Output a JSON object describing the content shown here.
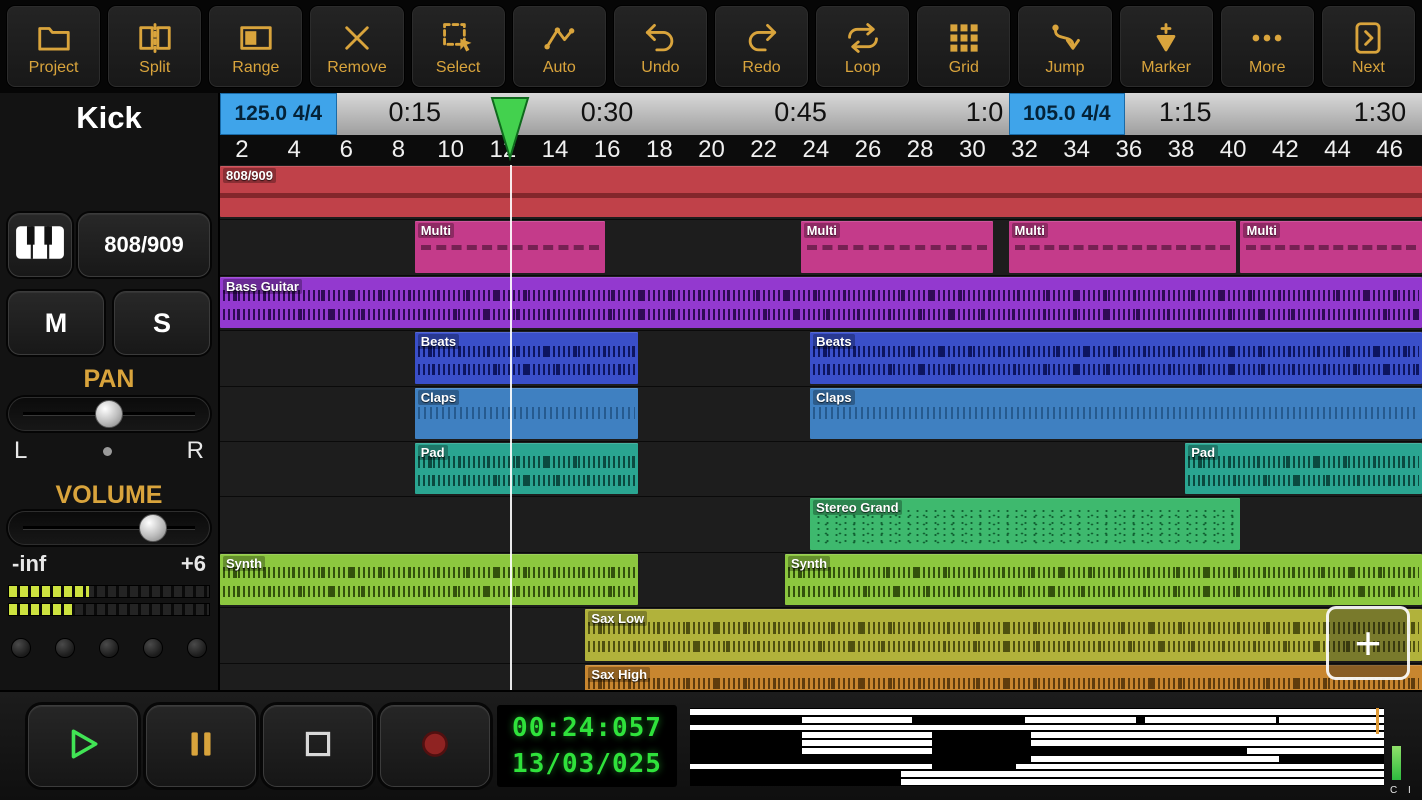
{
  "toolbar": {
    "items": [
      {
        "label": "Project",
        "icon": "folder"
      },
      {
        "label": "Split",
        "icon": "split"
      },
      {
        "label": "Range",
        "icon": "range"
      },
      {
        "label": "Remove",
        "icon": "remove"
      },
      {
        "label": "Select",
        "icon": "select"
      },
      {
        "label": "Auto",
        "icon": "auto"
      },
      {
        "label": "Undo",
        "icon": "undo"
      },
      {
        "label": "Redo",
        "icon": "redo"
      },
      {
        "label": "Loop",
        "icon": "loop"
      },
      {
        "label": "Grid",
        "icon": "grid"
      },
      {
        "label": "Jump",
        "icon": "jump"
      },
      {
        "label": "Marker",
        "icon": "marker"
      },
      {
        "label": "More",
        "icon": "more"
      },
      {
        "label": "Next",
        "icon": "next"
      }
    ]
  },
  "panel": {
    "track_name": "Kick",
    "instrument": "808/909",
    "mute": "M",
    "solo": "S",
    "pan_label": "PAN",
    "pan_left": "L",
    "pan_right": "R",
    "volume_label": "VOLUME",
    "volume_min": "-inf",
    "volume_max": "+6"
  },
  "ruler": {
    "tempo_markers": [
      {
        "label": "125.0  4/4",
        "left_pct": 0
      },
      {
        "label": "105.0  4/4",
        "left_pct": 65.6
      }
    ],
    "time_labels": [
      {
        "label": "0:15",
        "center_pct": 16.2
      },
      {
        "label": "0:30",
        "center_pct": 32.2
      },
      {
        "label": "0:45",
        "center_pct": 48.3
      },
      {
        "label": "1:0",
        "center_pct": 63.6
      },
      {
        "label": "1:15",
        "center_pct": 80.3
      },
      {
        "label": "1:30",
        "center_pct": 96.5
      }
    ],
    "bar_numbers": [
      "2",
      "4",
      "6",
      "8",
      "10",
      "12",
      "14",
      "16",
      "18",
      "20",
      "22",
      "24",
      "26",
      "28",
      "30",
      "32",
      "34",
      "36",
      "38",
      "40",
      "42",
      "44",
      "46"
    ]
  },
  "timeline": {
    "add_button_label": "+"
  },
  "tracks": [
    {
      "name": "808/909",
      "color": "#c04149",
      "accent": "#7c2328",
      "clips": [
        {
          "label": "808/909",
          "left_pct": 0,
          "width_pct": 100,
          "style": "midiline"
        }
      ]
    },
    {
      "name": "Multi",
      "color": "#c43b8a",
      "accent": "#6e1f4e",
      "clips": [
        {
          "label": "Multi",
          "left_pct": 16.2,
          "width_pct": 15.8,
          "style": "dashed"
        },
        {
          "label": "Multi",
          "left_pct": 48.3,
          "width_pct": 16.0,
          "style": "dashed"
        },
        {
          "label": "Multi",
          "left_pct": 65.6,
          "width_pct": 18.9,
          "style": "dashed"
        },
        {
          "label": "Multi",
          "left_pct": 84.9,
          "width_pct": 15.1,
          "style": "dashed"
        }
      ]
    },
    {
      "name": "Bass Guitar",
      "color": "#9339cf",
      "accent": "#2e0b55",
      "clips": [
        {
          "label": "Bass Guitar",
          "left_pct": 0,
          "width_pct": 100,
          "style": "wave2"
        }
      ]
    },
    {
      "name": "Beats",
      "color": "#3a4fc9",
      "accent": "#0d1560",
      "clips": [
        {
          "label": "Beats",
          "left_pct": 16.2,
          "width_pct": 18.6,
          "style": "wave2"
        },
        {
          "label": "Beats",
          "left_pct": 49.1,
          "width_pct": 50.9,
          "style": "wave2"
        }
      ]
    },
    {
      "name": "Claps",
      "color": "#3f80c1",
      "accent": "#123c66",
      "clips": [
        {
          "label": "Claps",
          "left_pct": 16.2,
          "width_pct": 18.6,
          "style": "wave1"
        },
        {
          "label": "Claps",
          "left_pct": 49.1,
          "width_pct": 50.9,
          "style": "wave1"
        }
      ]
    },
    {
      "name": "Pad",
      "color": "#2aa591",
      "accent": "#0b4a40",
      "clips": [
        {
          "label": "Pad",
          "left_pct": 16.2,
          "width_pct": 18.6,
          "style": "wave2"
        },
        {
          "label": "Pad",
          "left_pct": 80.3,
          "width_pct": 19.7,
          "style": "wave2"
        }
      ]
    },
    {
      "name": "Stereo Grand",
      "color": "#3eb96e",
      "accent": "#0e5a2e",
      "clips": [
        {
          "label": "Stereo Grand",
          "left_pct": 49.1,
          "width_pct": 35.8,
          "style": "dots"
        }
      ]
    },
    {
      "name": "Synth",
      "color": "#8cc73f",
      "accent": "#33520c",
      "clips": [
        {
          "label": "Synth",
          "left_pct": 0,
          "width_pct": 34.8,
          "style": "wave2"
        },
        {
          "label": "Synth",
          "left_pct": 47.0,
          "width_pct": 53.0,
          "style": "wave2"
        }
      ]
    },
    {
      "name": "Sax Low",
      "color": "#b1b23b",
      "accent": "#4f500f",
      "clips": [
        {
          "label": "Sax Low",
          "left_pct": 30.4,
          "width_pct": 69.6,
          "style": "wave2"
        }
      ]
    },
    {
      "name": "Sax High",
      "color": "#c8862f",
      "accent": "#5f3c0d",
      "clips": [
        {
          "label": "Sax High",
          "left_pct": 30.4,
          "width_pct": 69.6,
          "style": "wave2"
        }
      ]
    }
  ],
  "transport": {
    "time": "00:24:057",
    "date": "13/03/025",
    "meter_caption": "C I"
  }
}
